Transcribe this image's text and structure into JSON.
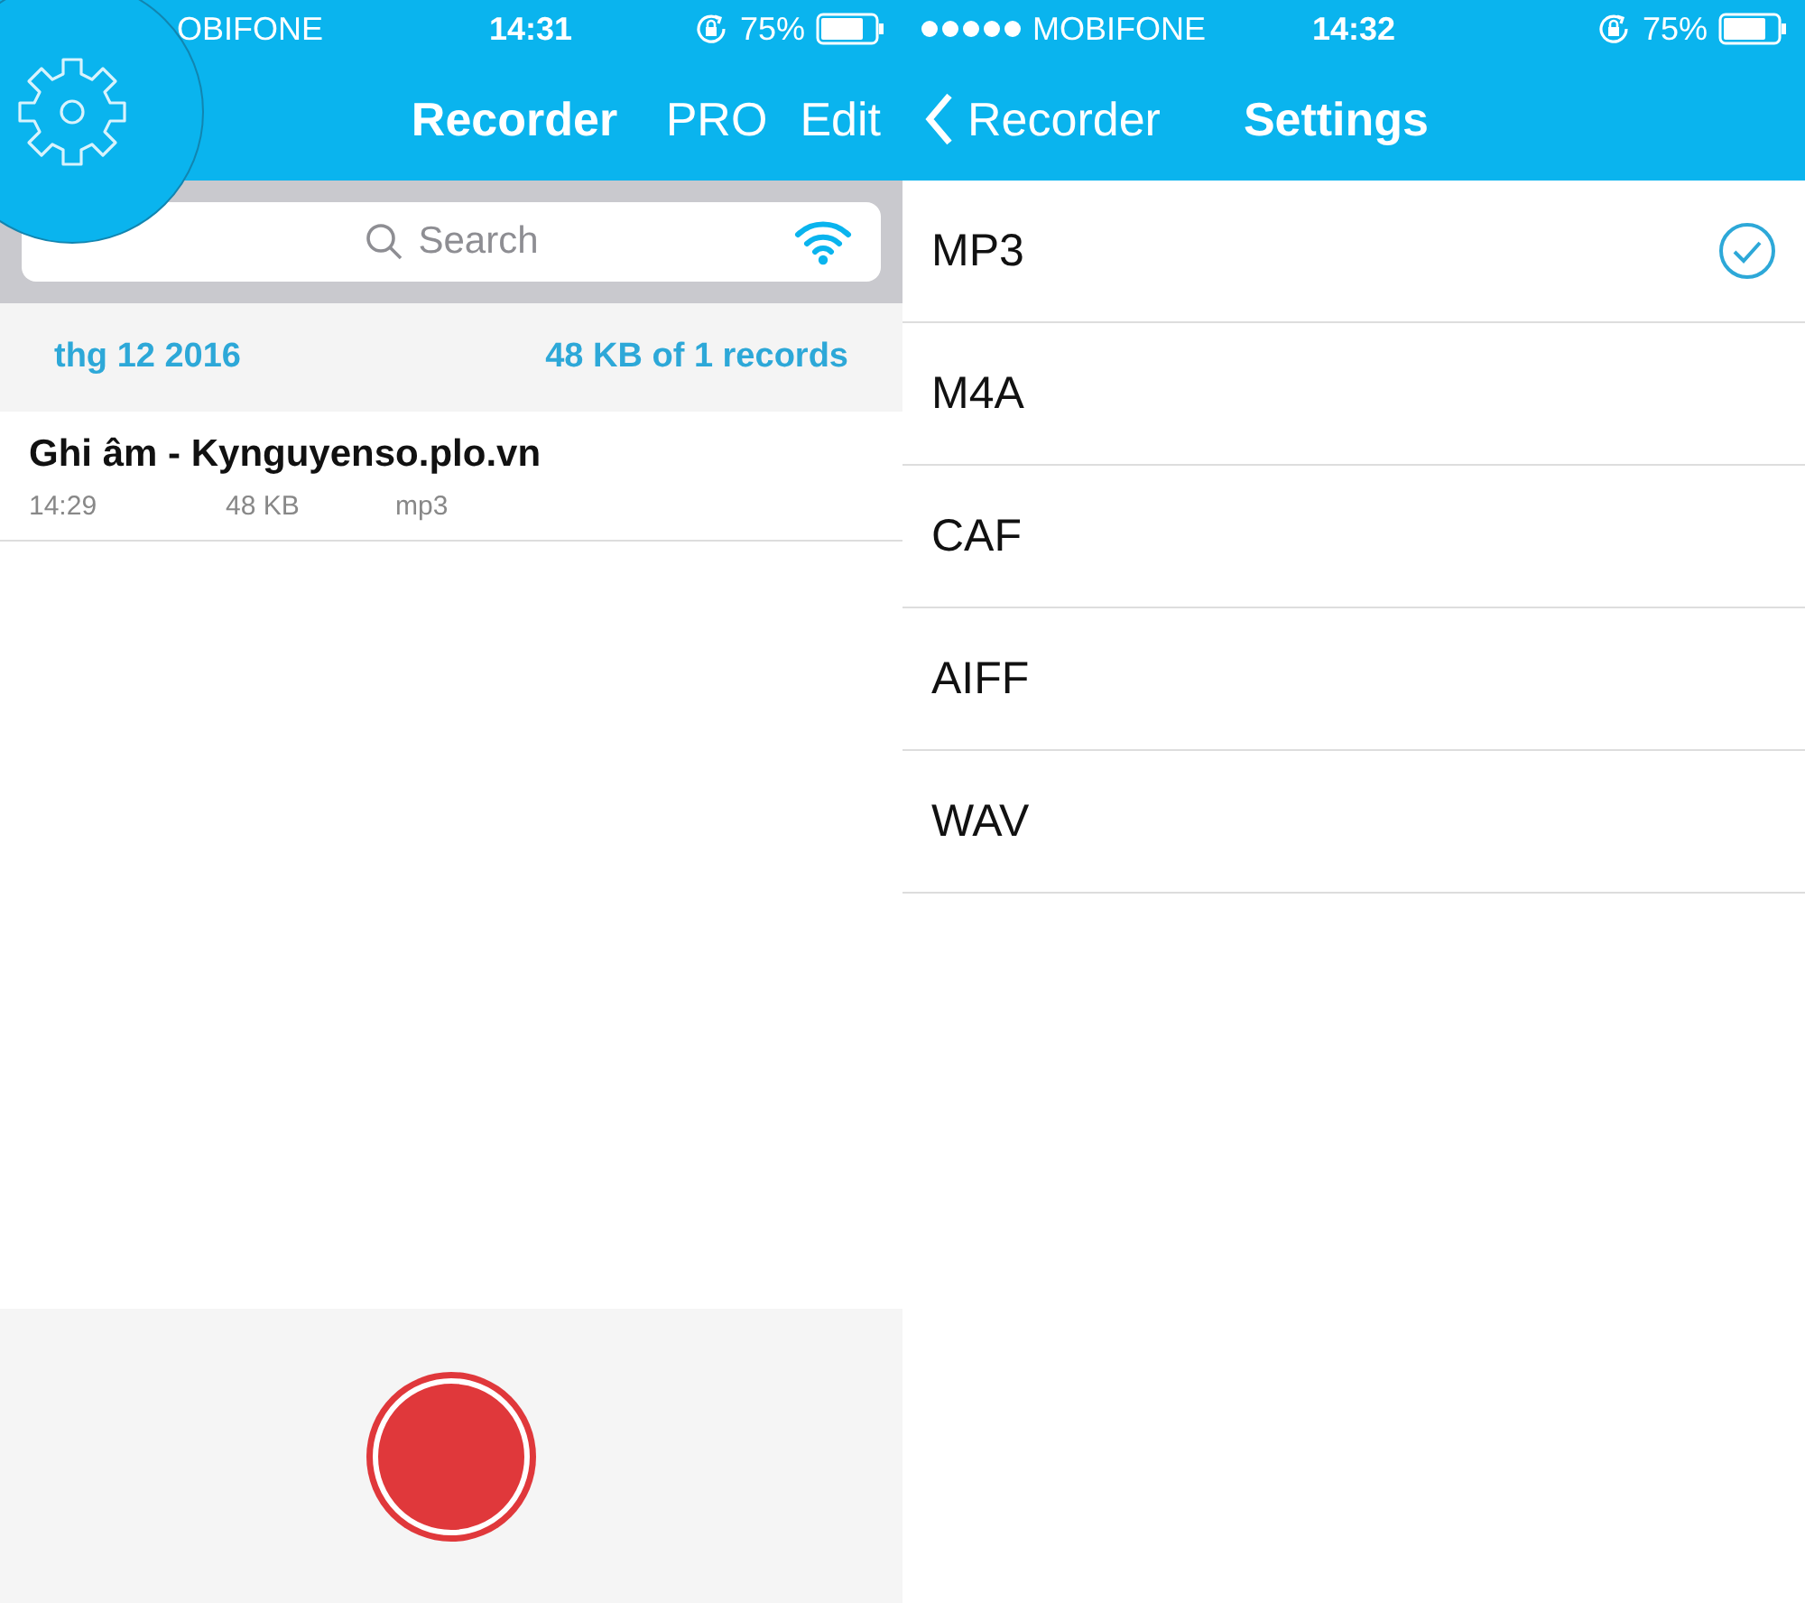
{
  "recorder_screen": {
    "status_bar": {
      "carrier": "OBIFONE",
      "time": "14:31",
      "battery": "75%"
    },
    "nav": {
      "title": "Recorder",
      "actions": [
        "PRO",
        "Edit"
      ]
    },
    "search": {
      "placeholder": "Search"
    },
    "section": {
      "date": "thg 12 2016",
      "summary": "48 KB of 1 records"
    },
    "records": [
      {
        "name": "Ghi âm - Kynguyenso.plo.vn",
        "time": "14:29",
        "size": "48 KB",
        "format": "mp3"
      }
    ]
  },
  "settings_screen": {
    "status_bar": {
      "carrier": "MOBIFONE",
      "time": "14:32",
      "battery": "75%"
    },
    "nav": {
      "back": "Recorder",
      "title": "Settings"
    },
    "formats": [
      {
        "label": "MP3",
        "selected": true
      },
      {
        "label": "M4A",
        "selected": false
      },
      {
        "label": "CAF",
        "selected": false
      },
      {
        "label": "AIFF",
        "selected": false
      },
      {
        "label": "WAV",
        "selected": false
      }
    ]
  }
}
